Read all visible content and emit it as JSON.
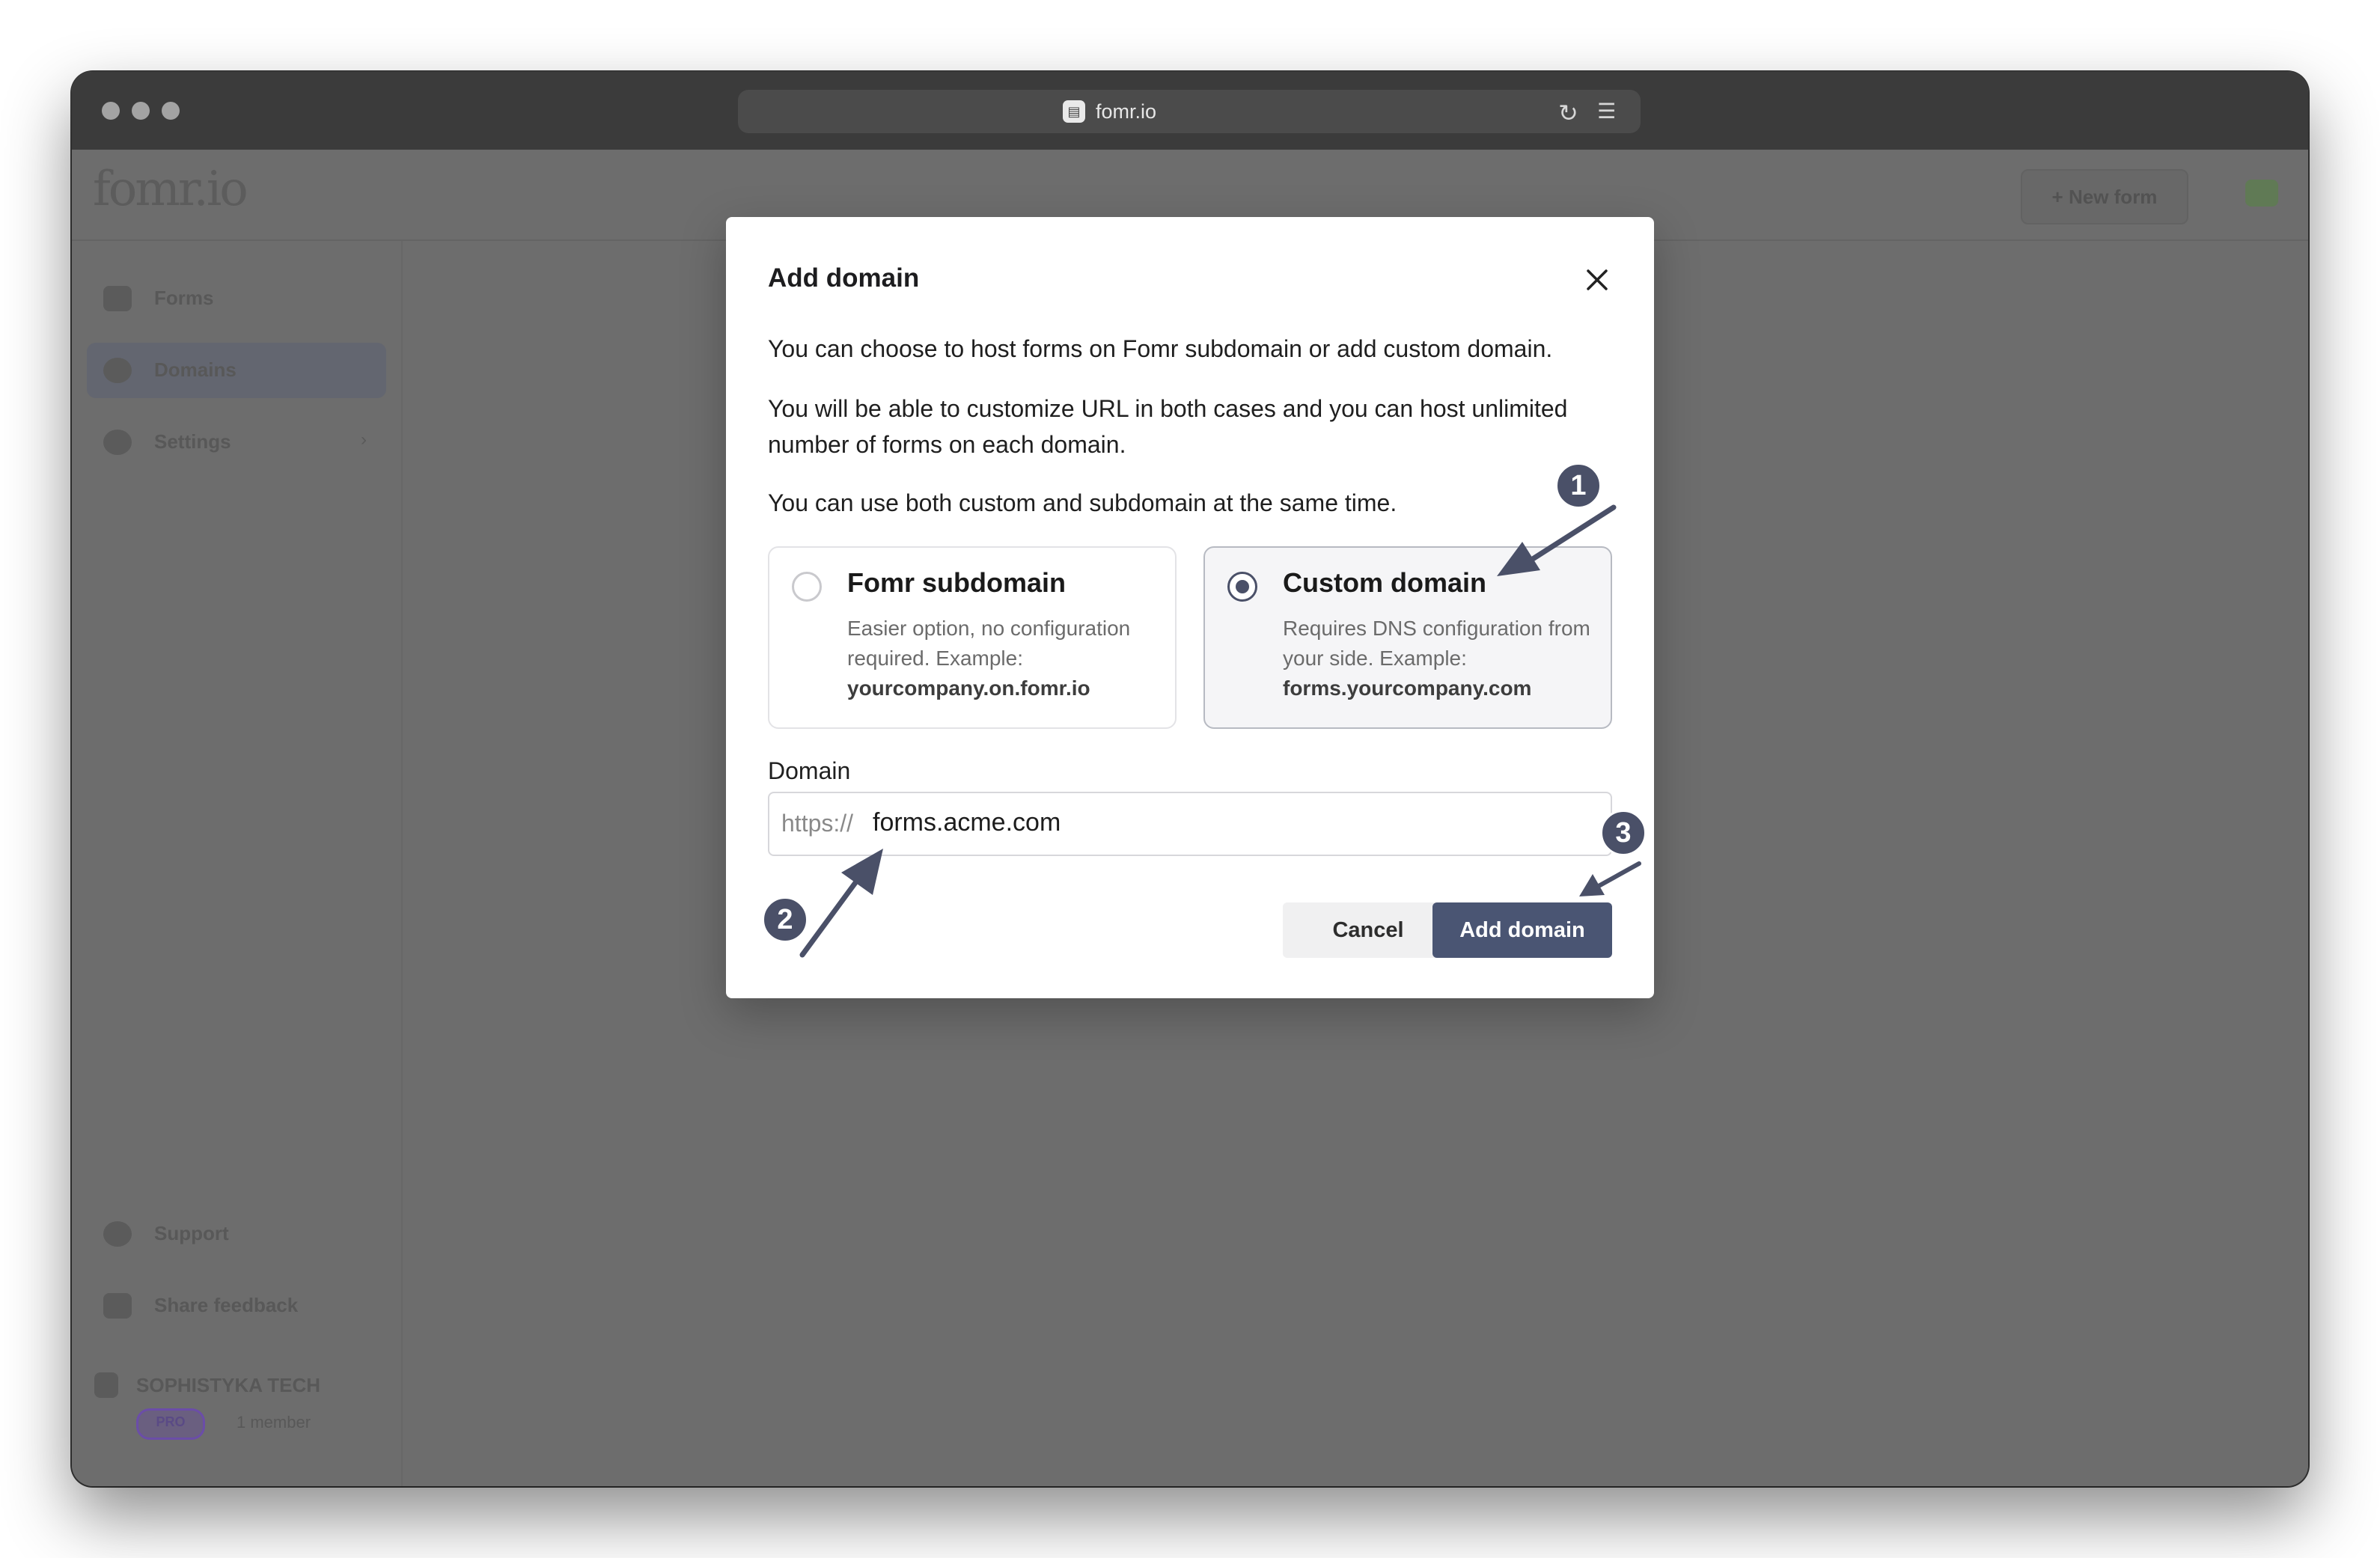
{
  "browser": {
    "url": "fomr.io"
  },
  "app": {
    "logo": "fomr.io",
    "new_form_label": "New form",
    "sidebar": {
      "items": [
        {
          "label": "Forms"
        },
        {
          "label": "Domains"
        },
        {
          "label": "Settings"
        }
      ],
      "footer_items": [
        {
          "label": "Support"
        },
        {
          "label": "Share feedback"
        }
      ],
      "workspace_name": "SOPHISTYKA TECH",
      "plan_badge": "PRO",
      "members": "1 member"
    }
  },
  "modal": {
    "title": "Add domain",
    "paragraph_1": "You can choose to host forms on Fomr subdomain or add custom domain.",
    "paragraph_2": "You will be able to customize URL in both cases and you can host unlimited number of forms on each domain.",
    "paragraph_3": "You can use both custom and subdomain at the same time.",
    "options": [
      {
        "title": "Fomr subdomain",
        "description": "Easier option, no configuration required. Example:",
        "example": "yourcompany.on.fomr.io",
        "selected": false
      },
      {
        "title": "Custom domain",
        "description": "Requires DNS configuration from your side. Example:",
        "example": "forms.yourcompany.com",
        "selected": true
      }
    ],
    "domain_label": "Domain",
    "domain_prefix": "https://",
    "domain_value": "forms.acme.com",
    "cancel_label": "Cancel",
    "submit_label": "Add domain"
  },
  "annotations": {
    "step_1": "1",
    "step_2": "2",
    "step_3": "3",
    "color": "#4a5068"
  }
}
